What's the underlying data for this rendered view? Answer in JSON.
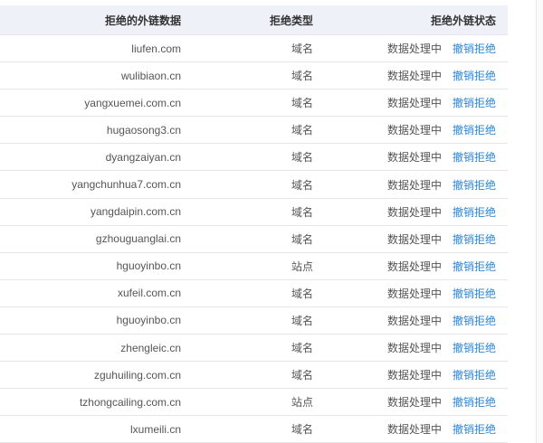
{
  "table": {
    "headers": {
      "domain": "拒绝的外链数据",
      "type": "拒绝类型",
      "status": "拒绝外链状态"
    },
    "rows": [
      {
        "domain": "liufen.com",
        "type": "域名",
        "status": "数据处理中",
        "action": "撤销拒绝"
      },
      {
        "domain": "wulibiaon.cn",
        "type": "域名",
        "status": "数据处理中",
        "action": "撤销拒绝"
      },
      {
        "domain": "yangxuemei.com.cn",
        "type": "域名",
        "status": "数据处理中",
        "action": "撤销拒绝"
      },
      {
        "domain": "hugaosong3.cn",
        "type": "域名",
        "status": "数据处理中",
        "action": "撤销拒绝"
      },
      {
        "domain": "dyangzaiyan.cn",
        "type": "域名",
        "status": "数据处理中",
        "action": "撤销拒绝"
      },
      {
        "domain": "yangchunhua7.com.cn",
        "type": "域名",
        "status": "数据处理中",
        "action": "撤销拒绝"
      },
      {
        "domain": "yangdaipin.com.cn",
        "type": "域名",
        "status": "数据处理中",
        "action": "撤销拒绝"
      },
      {
        "domain": "gzhouguanglai.cn",
        "type": "域名",
        "status": "数据处理中",
        "action": "撤销拒绝"
      },
      {
        "domain": "hguoyinbo.cn",
        "type": "站点",
        "status": "数据处理中",
        "action": "撤销拒绝"
      },
      {
        "domain": "xufeil.com.cn",
        "type": "域名",
        "status": "数据处理中",
        "action": "撤销拒绝"
      },
      {
        "domain": "hguoyinbo.cn",
        "type": "域名",
        "status": "数据处理中",
        "action": "撤销拒绝"
      },
      {
        "domain": "zhengleic.cn",
        "type": "域名",
        "status": "数据处理中",
        "action": "撤销拒绝"
      },
      {
        "domain": "zguhuiling.com.cn",
        "type": "域名",
        "status": "数据处理中",
        "action": "撤销拒绝"
      },
      {
        "domain": "tzhongcailing.com.cn",
        "type": "站点",
        "status": "数据处理中",
        "action": "撤销拒绝"
      },
      {
        "domain": "lxumeili.cn",
        "type": "域名",
        "status": "数据处理中",
        "action": "撤销拒绝"
      }
    ]
  },
  "colors": {
    "header_bg": "#eef2f8",
    "link": "#2b86d8",
    "text": "#555555"
  }
}
